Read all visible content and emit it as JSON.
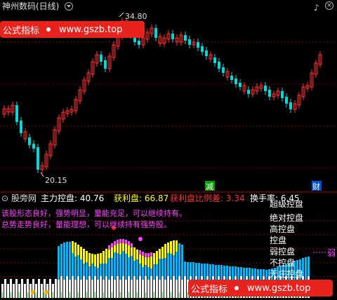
{
  "window": {
    "title": "神州数码(日线)"
  },
  "banner_top": {
    "label": "公式指标",
    "url": "www.gszb.top"
  },
  "banner_bottom": {
    "label": "公式指标",
    "url": "www.gszb.top"
  },
  "price_chart": {
    "high_label": "34.80",
    "low_label": "20.15",
    "marker_left": "减",
    "marker_right": "财"
  },
  "indicator": {
    "name": "股旁网",
    "fields": [
      {
        "label": "主力控盘:",
        "value": "40.76",
        "color": "#ffffff"
      },
      {
        "label": "获利盘:",
        "value": "66.87",
        "color": "#ffff00"
      },
      {
        "label": "获利盘比例差:",
        "value": "3.34",
        "color": "#ff3030"
      },
      {
        "label": "换手率:",
        "value": "6.45",
        "color": "#ffffff"
      }
    ],
    "message_1": "该股形态良好，强势明显，量能充足，可以继续持有。",
    "message_2": "总势走势良好，量能理想，可以继续持有强势股。",
    "levels": [
      "绝对控盘",
      "高控盘",
      "控盘",
      "弱控盘",
      "不控盘",
      "无庄控盘"
    ],
    "level_top_partial": "超级控盘",
    "right_tag": "弱"
  },
  "colors": {
    "up": "#ff3232",
    "down": "#00d7d7",
    "banner": "#e8231e",
    "dotted": "#8b0000"
  }
}
